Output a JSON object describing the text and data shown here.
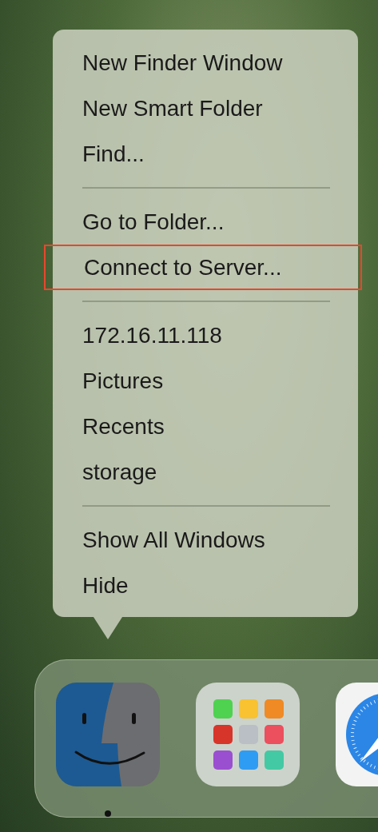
{
  "menu": {
    "sections": [
      {
        "items": [
          {
            "label": "New Finder Window",
            "highlighted": false
          },
          {
            "label": "New Smart Folder",
            "highlighted": false
          },
          {
            "label": "Find...",
            "highlighted": false
          }
        ]
      },
      {
        "items": [
          {
            "label": "Go to Folder...",
            "highlighted": false
          },
          {
            "label": "Connect to Server...",
            "highlighted": true
          }
        ]
      },
      {
        "items": [
          {
            "label": "172.16.11.118",
            "highlighted": false
          },
          {
            "label": "Pictures",
            "highlighted": false
          },
          {
            "label": "Recents",
            "highlighted": false
          },
          {
            "label": "storage",
            "highlighted": false
          }
        ]
      },
      {
        "items": [
          {
            "label": "Show All Windows",
            "highlighted": false
          },
          {
            "label": "Hide",
            "highlighted": false
          }
        ]
      }
    ]
  },
  "dock": {
    "apps": [
      {
        "kind": "finder",
        "running": true
      },
      {
        "kind": "launchpad",
        "running": false
      },
      {
        "kind": "safari",
        "running": false
      }
    ]
  }
}
